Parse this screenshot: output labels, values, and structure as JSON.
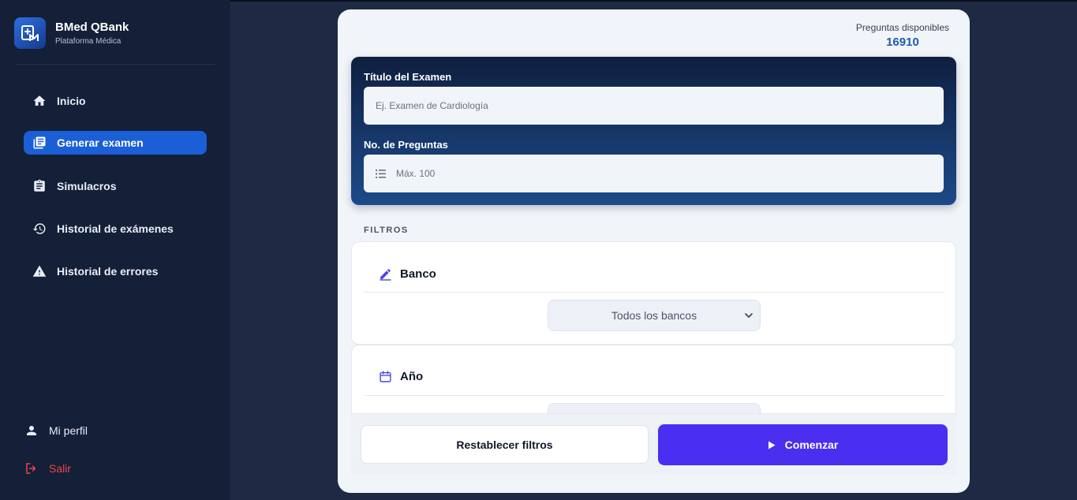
{
  "brand": {
    "title": "BMed QBank",
    "subtitle": "Plataforma Médica"
  },
  "sidebar": {
    "items": [
      {
        "label": "Inicio",
        "icon": "home-icon",
        "active": false
      },
      {
        "label": "Generar examen",
        "icon": "document-icon",
        "active": true
      },
      {
        "label": "Simulacros",
        "icon": "clipboard-icon",
        "active": false
      },
      {
        "label": "Historial de exámenes",
        "icon": "history-icon",
        "active": false
      },
      {
        "label": "Historial de errores",
        "icon": "warning-icon",
        "active": false
      }
    ],
    "profile_label": "Mi perfil",
    "logout_label": "Salir"
  },
  "stats": {
    "available_label": "Preguntas disponibles",
    "available_count": "16910"
  },
  "form": {
    "title_label": "Título del Examen",
    "title_placeholder": "Ej. Examen de Cardiología",
    "count_label": "No. de Preguntas",
    "count_placeholder": "Máx. 100"
  },
  "filters": {
    "section_label": "FILTROS",
    "bank_label": "Banco",
    "bank_selected": "Todos los bancos",
    "year_label": "Año"
  },
  "actions": {
    "reset_label": "Restablecer filtros",
    "start_label": "Comenzar"
  },
  "colors": {
    "sidebar_bg": "#141f38",
    "accent_blue": "#1a5fd6",
    "primary_button": "#4a2ff0",
    "logout_red": "#ef4444",
    "filter_icon": "#4f46e5"
  }
}
